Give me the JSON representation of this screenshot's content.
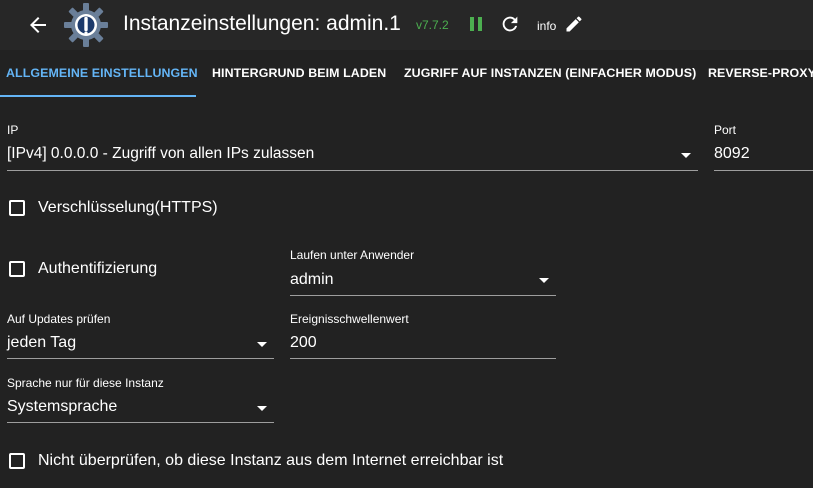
{
  "header": {
    "title": "Instanzeinstellungen: admin.1",
    "version": "v7.7.2",
    "info_label": "info",
    "icons": {
      "back": "arrow-back-icon",
      "logo": "iobroker-admin-logo",
      "pause": "pause-icon",
      "refresh": "refresh-icon",
      "edit": "pencil-icon"
    },
    "version_color": "#4caf50"
  },
  "tabs": [
    {
      "label": "Allgemeine Einstellungen",
      "active": true
    },
    {
      "label": "Hintergrund beim Laden",
      "active": false
    },
    {
      "label": "Zugriff auf Instanzen (einfacher Modus)",
      "active": false
    },
    {
      "label": "Reverse-Proxy",
      "active": false
    }
  ],
  "accent_color": "#64b5f6",
  "form": {
    "ip": {
      "label": "IP",
      "value": "[IPv4] 0.0.0.0 - Zugriff von allen IPs zulassen"
    },
    "port": {
      "label": "Port",
      "value": "8092"
    },
    "https": {
      "label": "Verschlüsselung(HTTPS)",
      "checked": false
    },
    "auth": {
      "label": "Authentifizierung",
      "checked": false
    },
    "run_as": {
      "label": "Laufen unter Anwender",
      "value": "admin"
    },
    "updates": {
      "label": "Auf Updates prüfen",
      "value": "jeden Tag"
    },
    "threshold": {
      "label": "Ereignisschwellenwert",
      "value": "200"
    },
    "language": {
      "label": "Sprache nur für diese Instanz",
      "value": "Systemsprache"
    },
    "no_check": {
      "label": "Nicht überprüfen, ob diese Instanz aus dem Internet erreichbar ist",
      "checked": false
    }
  }
}
